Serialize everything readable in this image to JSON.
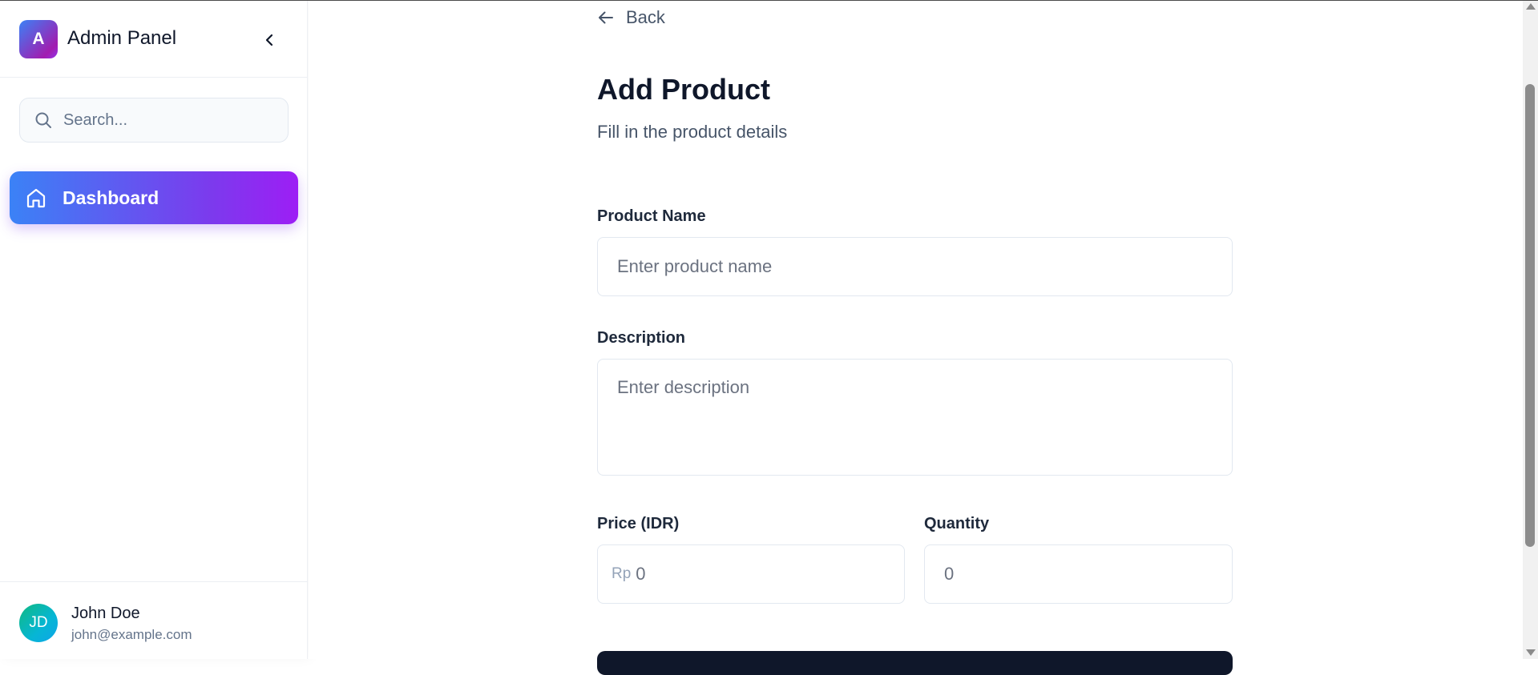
{
  "sidebar": {
    "brand": {
      "logo_letter": "A",
      "title": "Admin Panel"
    },
    "collapse_icon": "chevron-left-icon",
    "search": {
      "placeholder": "Search...",
      "value": ""
    },
    "nav": [
      {
        "label": "Dashboard",
        "icon": "home-icon",
        "active": true
      }
    ],
    "user": {
      "initials": "JD",
      "name": "John Doe",
      "email": "john@example.com"
    }
  },
  "main": {
    "back_label": "Back",
    "title": "Add Product",
    "subtitle": "Fill in the product details",
    "form": {
      "product_name": {
        "label": "Product Name",
        "placeholder": "Enter product name",
        "value": ""
      },
      "description": {
        "label": "Description",
        "placeholder": "Enter description",
        "value": ""
      },
      "price": {
        "label": "Price (IDR)",
        "prefix": "Rp",
        "placeholder": "0",
        "value": ""
      },
      "quantity": {
        "label": "Quantity",
        "placeholder": "0",
        "value": ""
      }
    }
  },
  "colors": {
    "accent_from": "#3b82f6",
    "accent_to": "#9333ea",
    "text_dark": "#0f172a",
    "text_muted": "#475569"
  }
}
